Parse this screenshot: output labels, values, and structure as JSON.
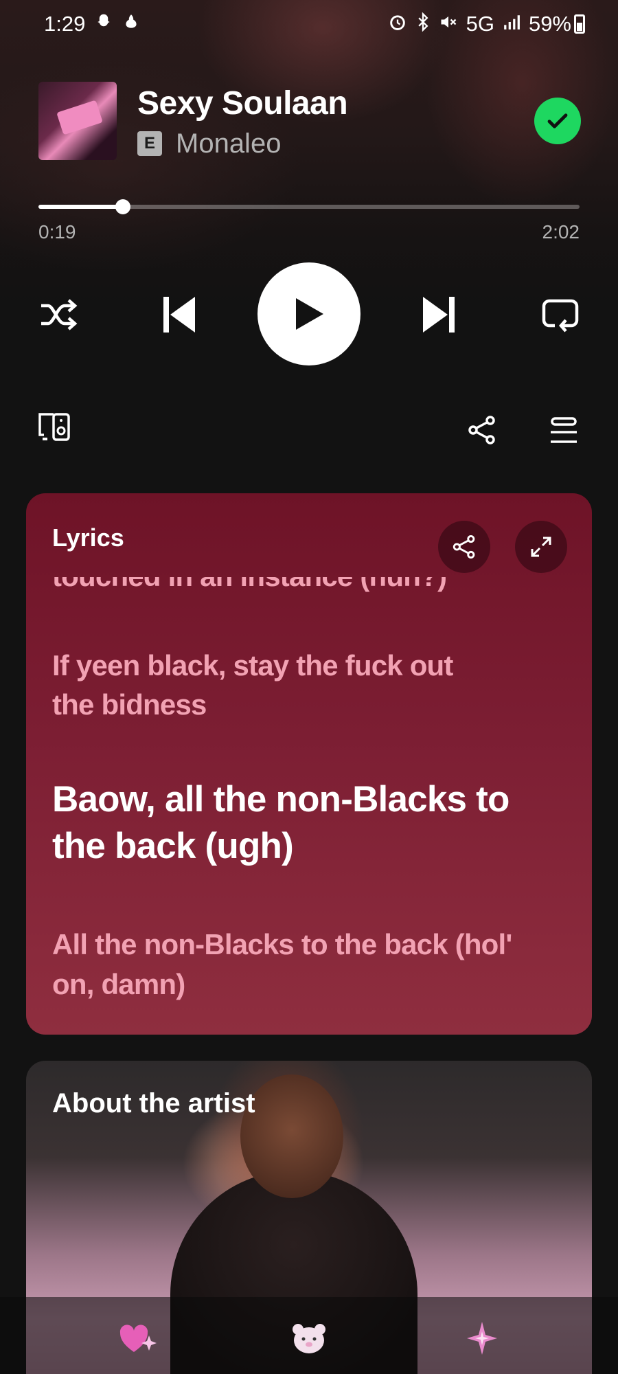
{
  "status_bar": {
    "time": "1:29",
    "network": "5G",
    "battery": "59%",
    "left_icons": [
      "snapchat-icon",
      "notification-icon"
    ],
    "right_icons": [
      "alarm-icon",
      "bluetooth-icon",
      "mute-icon",
      "signal-icon"
    ]
  },
  "now_playing": {
    "title": "Sexy Soulaan",
    "explicit_label": "E",
    "artist": "Monaleo",
    "saved": true,
    "elapsed": "0:19",
    "duration": "2:02",
    "progress": 0.156
  },
  "controls": [
    "shuffle",
    "previous",
    "play",
    "next",
    "repeat"
  ],
  "utility": [
    "connect-device",
    "share",
    "queue"
  ],
  "lyrics": {
    "header": "Lyrics",
    "cut_line": "touched in an instance (huh?)",
    "past_line": "If yeen black, stay the fuck out the bidness",
    "current_line": "Baow, all the non-Blacks to the back (ugh)",
    "next_line": "All the non-Blacks to the back (hol' on, damn)"
  },
  "about": {
    "title": "About the artist"
  },
  "colors": {
    "accent": "#1ed760",
    "lyrics_bg": "#7c1e33",
    "lyric_dim": "#f2a2b3"
  },
  "bottom_nav": [
    "heart-sparkle-icon",
    "bear-icon",
    "sparkle-icon"
  ]
}
